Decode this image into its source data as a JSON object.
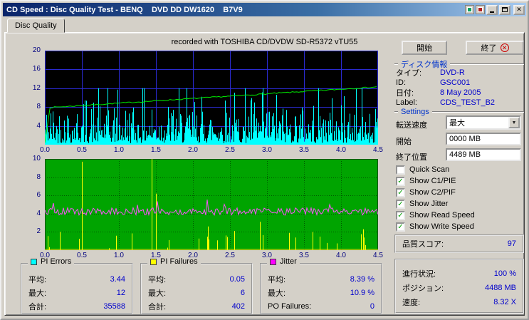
{
  "window": {
    "title": "CD Speed : Disc Quality Test - BENQ    DVD DD DW1620    B7V9"
  },
  "tab": {
    "label": "Disc Quality"
  },
  "header_note": "recorded with TOSHIBA CD/DVDW SD-R5372 vTU55",
  "buttons": {
    "start": "開始",
    "exit": "終了"
  },
  "disc_info": {
    "header": "ディスク情報",
    "rows": [
      {
        "label": "タイプ:",
        "value": "DVD-R"
      },
      {
        "label": "ID:",
        "value": "GSC001"
      },
      {
        "label": "日付:",
        "value": "8 May 2005"
      },
      {
        "label": "Label:",
        "value": "CDS_TEST_B2"
      }
    ]
  },
  "settings": {
    "header": "Settings",
    "fields": [
      {
        "label": "転送速度",
        "value": "最大",
        "type": "select"
      },
      {
        "label": "開始",
        "value": "0000 MB",
        "type": "input"
      },
      {
        "label": "終了位置",
        "value": "4489 MB",
        "type": "input"
      }
    ],
    "checkboxes": [
      {
        "label": "Quick Scan",
        "checked": false
      },
      {
        "label": "Show C1/PIE",
        "checked": true
      },
      {
        "label": "Show C2/PIF",
        "checked": true
      },
      {
        "label": "Show Jitter",
        "checked": true
      },
      {
        "label": "Show Read Speed",
        "checked": true
      },
      {
        "label": "Show Write Speed",
        "checked": true
      }
    ]
  },
  "quality_score": {
    "label": "品質スコア:",
    "value": "97"
  },
  "status": {
    "rows": [
      {
        "label": "進行状況:",
        "value": "100 %"
      },
      {
        "label": "ポジション:",
        "value": "4488 MB"
      },
      {
        "label": "速度:",
        "value": "8.32 X"
      }
    ]
  },
  "stats_boxes": [
    {
      "legend": "PI Errors",
      "color": "#00ffff",
      "rows": [
        {
          "label": "平均:",
          "value": "3.44"
        },
        {
          "label": "最大:",
          "value": "12"
        },
        {
          "label": "合計:",
          "value": "35588"
        }
      ]
    },
    {
      "legend": "PI Failures",
      "color": "#ffff00",
      "rows": [
        {
          "label": "平均:",
          "value": "0.05"
        },
        {
          "label": "最大:",
          "value": "6"
        },
        {
          "label": "合計:",
          "value": "402"
        }
      ]
    },
    {
      "legend": "Jitter",
      "color": "#ff00ff",
      "rows": [
        {
          "label": "平均:",
          "value": "8.39 %"
        },
        {
          "label": "最大:",
          "value": "10.9 %"
        },
        {
          "label": "PO Failures:",
          "value": "0"
        }
      ]
    }
  ],
  "chart_data": [
    {
      "type": "area",
      "name": "pi-errors-chart",
      "title": "PI Errors / Write Speed vs disc position (GB)",
      "x_range": [
        0,
        4.5
      ],
      "x_ticks": [
        "0.0",
        "0.5",
        "1.0",
        "1.5",
        "2.0",
        "2.5",
        "3.0",
        "3.5",
        "4.0",
        "4.5"
      ],
      "y_range": [
        0,
        20
      ],
      "y_ticks": [
        4,
        8,
        12,
        16,
        20
      ],
      "bg": "#000000",
      "grid": "#2a2ad0",
      "grid_dash": "",
      "series": [
        {
          "name": "PI Errors",
          "color": "#00ffff",
          "style": "dense-spikes",
          "mean": 3.44,
          "max": 12,
          "seed": 42
        },
        {
          "name": "Write Speed",
          "color": "#00ee00",
          "style": "ramp-line",
          "start_x": 0.07,
          "start_y": 7.9,
          "end_y": 12.3,
          "noise": 0.12,
          "seed": 7
        }
      ]
    },
    {
      "type": "area",
      "name": "pi-failures-jitter-chart",
      "title": "PI Failures / Jitter vs disc position (GB)",
      "x_range": [
        0,
        4.5
      ],
      "x_ticks": [
        "0.0",
        "0.5",
        "1.0",
        "1.5",
        "2.0",
        "2.5",
        "3.0",
        "3.5",
        "4.0",
        "4.5"
      ],
      "y_range": [
        0,
        10
      ],
      "y_ticks": [
        2,
        4,
        6,
        8,
        10
      ],
      "bg": "#00a400",
      "grid": "#005500",
      "grid_dash": "1,2",
      "series": [
        {
          "name": "PI Failures",
          "color": "#ffff00",
          "style": "sparse-spikes",
          "prob": 0.13,
          "small_max": 1.7,
          "seed": 99,
          "fixed": [
            [
              0.2,
              2.0
            ],
            [
              0.5,
              9.7
            ],
            [
              1.44,
              10
            ],
            [
              1.5,
              6.2
            ],
            [
              2.2,
              2.6
            ],
            [
              2.56,
              2.1
            ],
            [
              2.9,
              3.1
            ],
            [
              3.3,
              1.9
            ],
            [
              3.62,
              2.0
            ],
            [
              4.3,
              2.3
            ]
          ]
        },
        {
          "name": "Jitter",
          "color": "#ff50ff",
          "style": "noisy-line",
          "base": 4.25,
          "noise": 0.4,
          "seed": 5
        }
      ]
    }
  ]
}
